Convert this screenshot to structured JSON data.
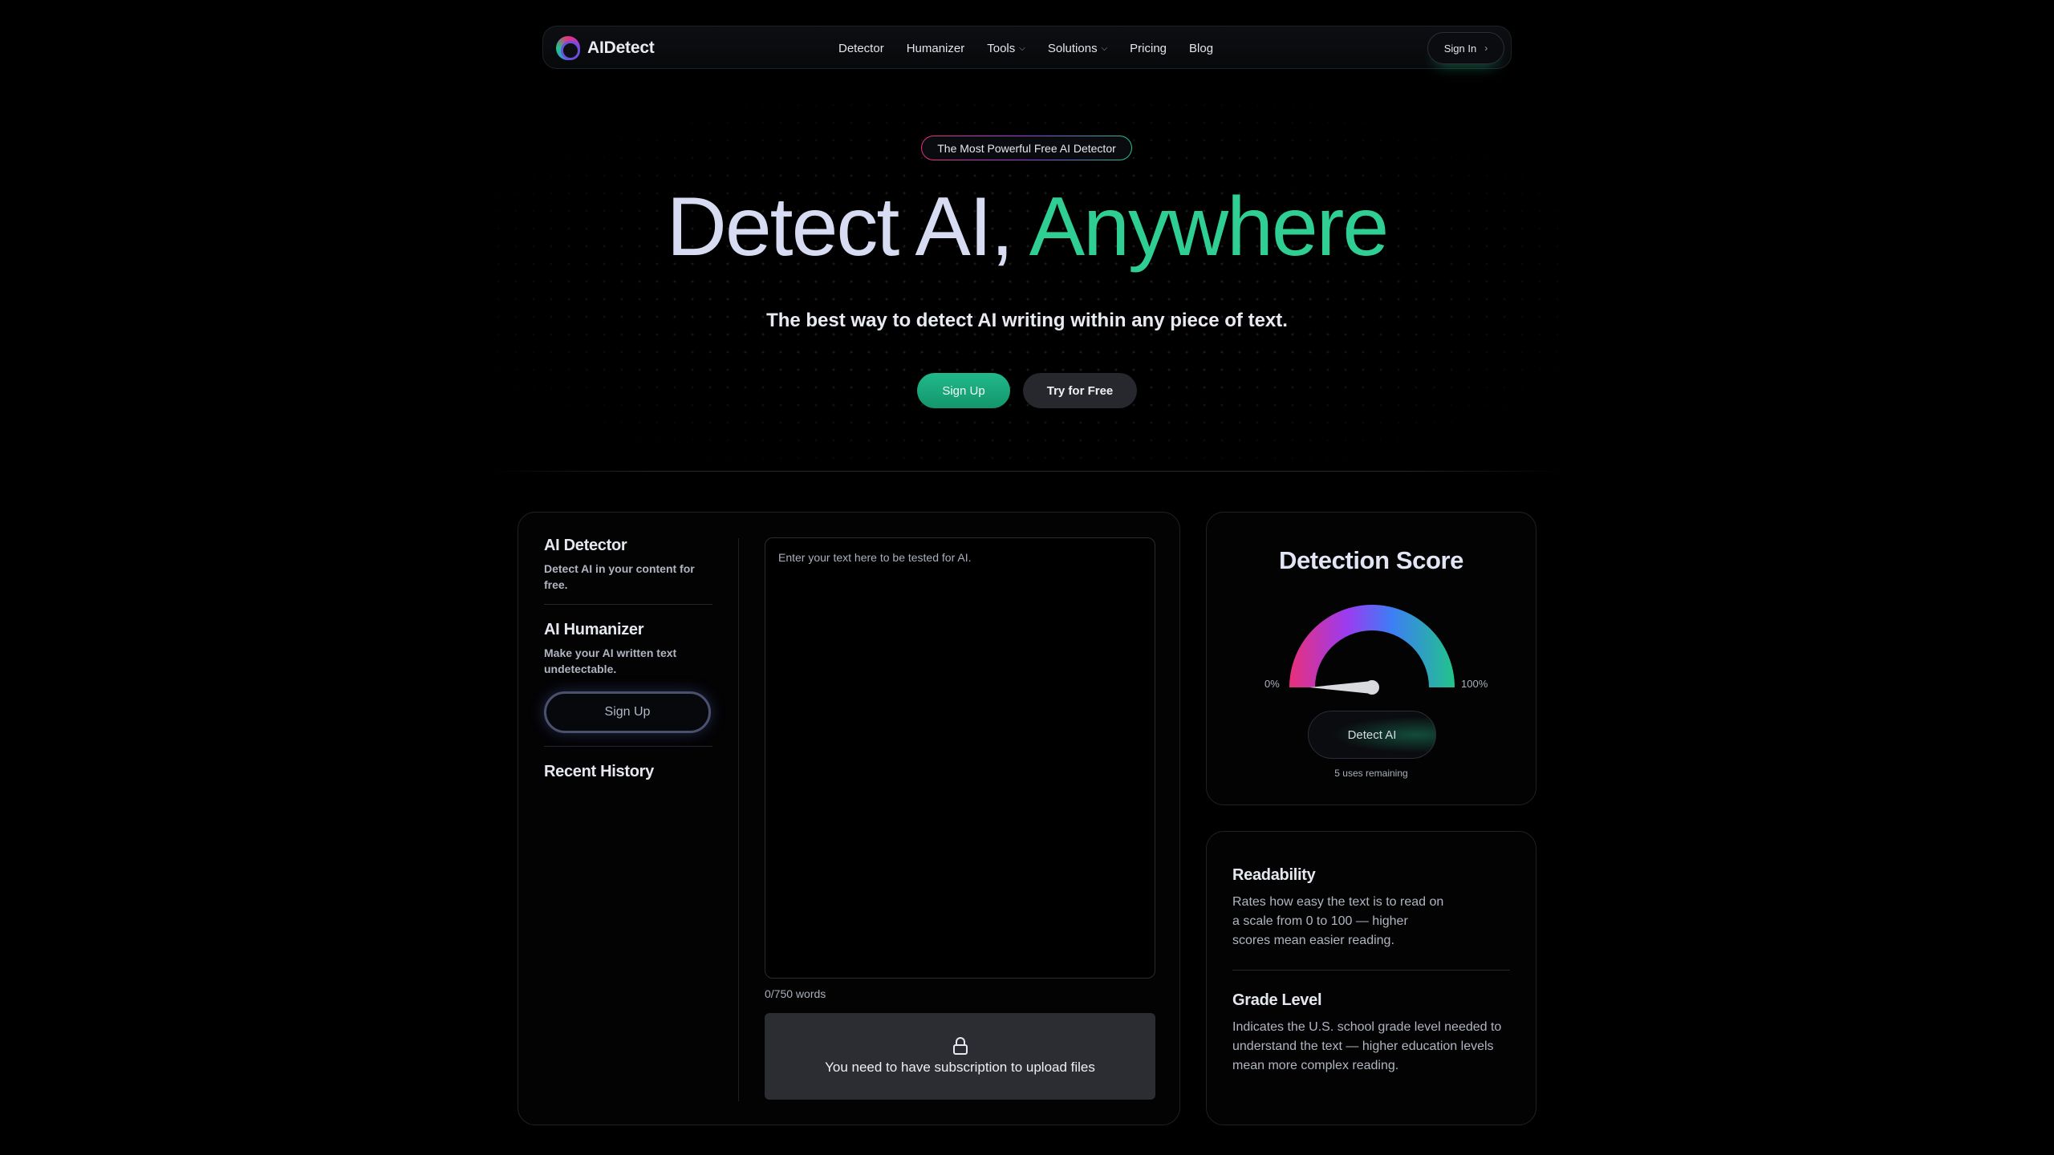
{
  "nav": {
    "logo_text": "AIDetect",
    "links": [
      {
        "label": "Detector",
        "has_dropdown": false
      },
      {
        "label": "Humanizer",
        "has_dropdown": false
      },
      {
        "label": "Tools",
        "has_dropdown": true
      },
      {
        "label": "Solutions",
        "has_dropdown": true
      },
      {
        "label": "Pricing",
        "has_dropdown": false
      },
      {
        "label": "Blog",
        "has_dropdown": false
      }
    ],
    "sign_in_label": "Sign In",
    "sign_in_arrow": "›"
  },
  "hero": {
    "badge": "The Most Powerful Free AI Detector",
    "title_part1": "Detect AI,",
    "title_part2": "Anywhere",
    "subtitle": "The best way to detect AI writing within any piece of text.",
    "sign_up_label": "Sign Up",
    "try_label": "Try for Free"
  },
  "sidebar": {
    "detector_title": "AI Detector",
    "detector_desc": "Detect AI in your content for free.",
    "humanizer_title": "AI Humanizer",
    "humanizer_desc": "Make your AI written text undetectable.",
    "sign_up_label": "Sign Up",
    "history_title": "Recent History"
  },
  "editor": {
    "placeholder": "Enter your text here to be tested for AI.",
    "value": "",
    "word_count": "0/750 words",
    "upload_message": "You need to have subscription to upload files"
  },
  "score": {
    "title": "Detection Score",
    "min_label": "0%",
    "max_label": "100%",
    "value": 0,
    "detect_label": "Detect AI",
    "uses_remaining": "5 uses remaining"
  },
  "info": {
    "readability_title": "Readability",
    "readability_desc": "Rates how easy the text is to read on a scale from 0 to 100 — higher scores mean easier reading.",
    "grade_title": "Grade Level",
    "grade_desc": "Indicates the U.S. school grade level needed to understand the text — higher education levels mean more complex reading."
  },
  "colors": {
    "accent_green": "#21c48a",
    "gauge_pink": "#e8307a",
    "gauge_purple": "#9b3cf0",
    "gauge_blue": "#3d7ef5"
  }
}
